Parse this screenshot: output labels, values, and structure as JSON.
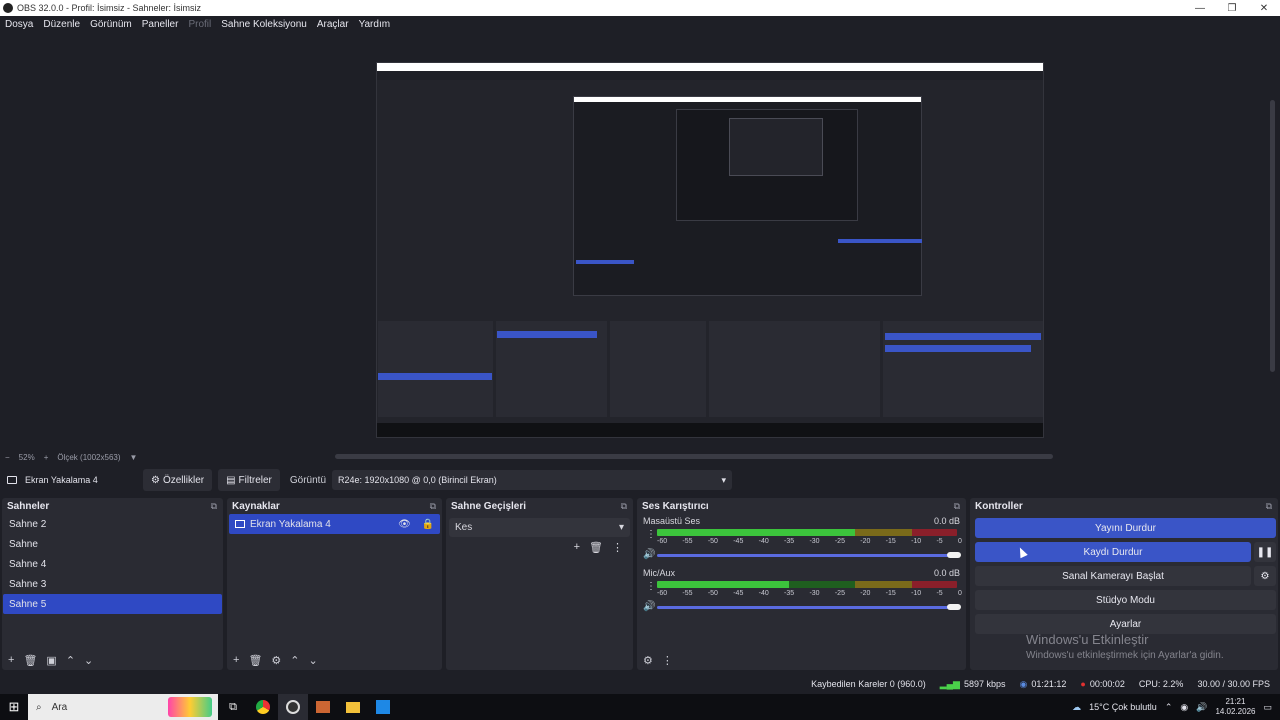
{
  "window": {
    "title": "OBS 32.0.0 - Profil: İsimsiz - Sahneler: İsimsiz",
    "min": "—",
    "max": "❐",
    "close": "✕"
  },
  "menu": [
    "Dosya",
    "Düzenle",
    "Görünüm",
    "Paneller",
    "Profil",
    "Sahne Koleksiyonu",
    "Araçlar",
    "Yardım"
  ],
  "preview": {
    "zoom": "52%",
    "scale_label": "Ölçek (1002x563)"
  },
  "source_toolbar": {
    "source_name": "Ekran Yakalama 4",
    "properties": "Özellikler",
    "filters": "Filtreler",
    "display_label": "Görüntü",
    "display_value": "R24e: 1920x1080 @ 0,0 (Birincil Ekran)"
  },
  "scenes": {
    "title": "Sahneler",
    "items": [
      "Sahne 2",
      "Sahne",
      "Sahne 4",
      "Sahne 3",
      "Sahne 5"
    ],
    "selected": "Sahne 5"
  },
  "sources": {
    "title": "Kaynaklar",
    "items": [
      "Ekran Yakalama 4"
    ]
  },
  "transitions": {
    "title": "Sahne Geçişleri",
    "value": "Kes"
  },
  "mixer": {
    "title": "Ses Karıştırıcı",
    "channels": [
      {
        "name": "Masaüstü Ses",
        "db": "0.0 dB",
        "level": 0.85
      },
      {
        "name": "Mic/Aux",
        "db": "0.0 dB",
        "level": 0.44
      }
    ],
    "ticks": [
      "-60",
      "-55",
      "-50",
      "-45",
      "-40",
      "-35",
      "-30",
      "-25",
      "-20",
      "-15",
      "-10",
      "-5",
      "0"
    ]
  },
  "controls": {
    "title": "Kontroller",
    "stop_stream": "Yayını Durdur",
    "stop_record": "Kaydı Durdur",
    "virtual_cam": "Sanal Kamerayı Başlat",
    "studio_mode": "Stüdyo Modu",
    "settings": "Ayarlar"
  },
  "watermark": {
    "line1": "Windows'u Etkinleştir",
    "line2": "Windows'u etkinleştirmek için Ayarlar'a gidin."
  },
  "status": {
    "dropped": "Kaybedilen Kareler 0 (960.0)",
    "bitrate": "5897 kbps",
    "stream_time": "01:21:12",
    "rec_time": "00:00:02",
    "cpu": "CPU: 2.2%",
    "fps": "30.00 / 30.00 FPS"
  },
  "taskbar": {
    "search": "Ara",
    "weather": "15°C  Çok bulutlu",
    "time": "21:21",
    "date": "14.02.2026"
  },
  "colors": {
    "accent": "#3a55c7",
    "selected": "#2f49c4",
    "panel": "#2a2b33",
    "bg": "#1e1f26"
  }
}
